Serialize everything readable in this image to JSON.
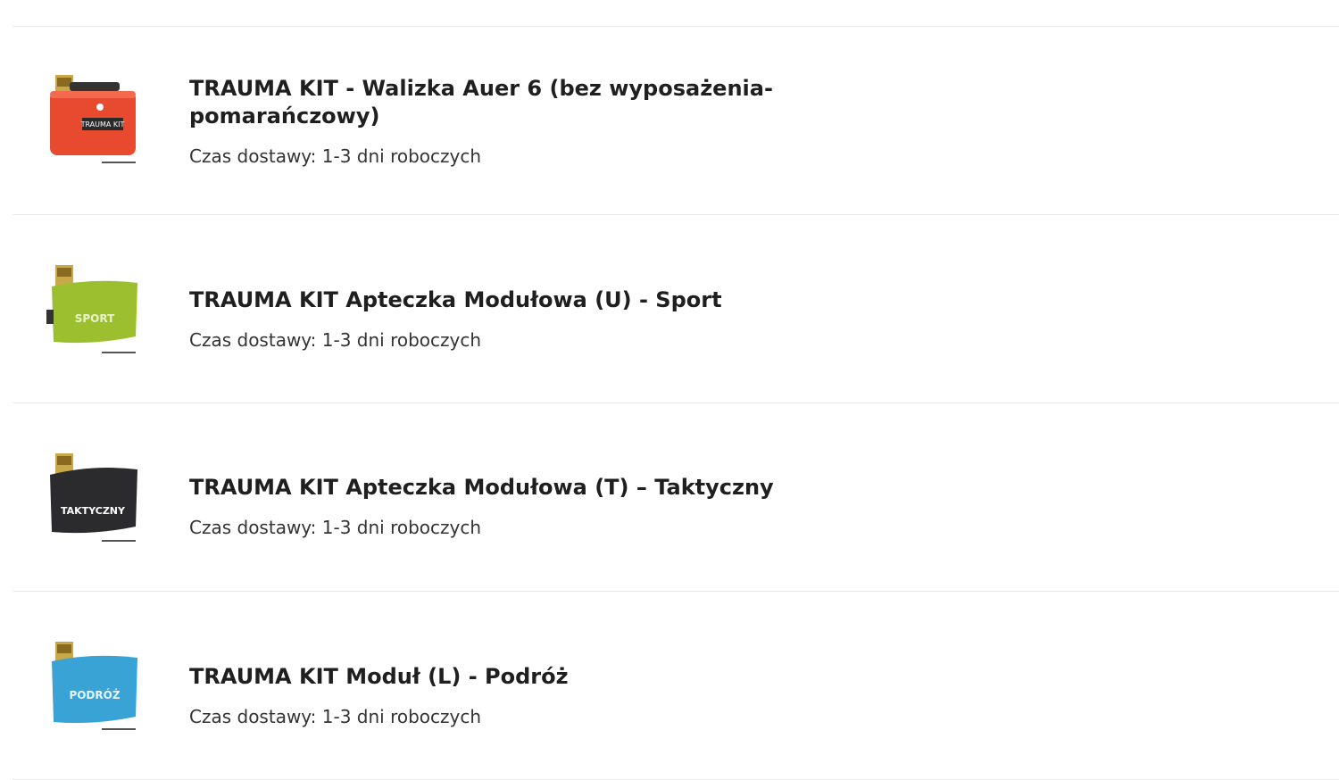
{
  "products": [
    {
      "title": "TRAUMA KIT - Walizka Auer 6 (bez wyposażenia-pomarańczowy)",
      "delivery_label": "Czas dostawy:",
      "delivery_value": "1-3 dni roboczych",
      "image": {
        "icon": "orange-case-image",
        "color": "#e84a2f",
        "text": "TRAUMA KIT"
      }
    },
    {
      "title": "TRAUMA KIT Apteczka Modułowa (U) - Sport",
      "delivery_label": "Czas dostawy:",
      "delivery_value": "1-3 dni roboczych",
      "image": {
        "icon": "green-pouch-image",
        "color": "#9bbf2e",
        "text": "SPORT"
      }
    },
    {
      "title": "TRAUMA KIT Apteczka Modułowa (T) – Taktyczny",
      "delivery_label": "Czas dostawy:",
      "delivery_value": "1-3 dni roboczych",
      "image": {
        "icon": "black-pouch-image",
        "color": "#2b2b2d",
        "text": "TAKTYCZNY"
      }
    },
    {
      "title": "TRAUMA KIT Moduł (L) - Podróż",
      "delivery_label": "Czas dostawy:",
      "delivery_value": "1-3 dni roboczych",
      "image": {
        "icon": "blue-pouch-image",
        "color": "#3aa3d6",
        "text": "PODRÓŻ"
      }
    }
  ],
  "colors": {
    "divider": "#e9e9e9",
    "text": "#1f1f1f",
    "badge": "#c9a84a"
  }
}
